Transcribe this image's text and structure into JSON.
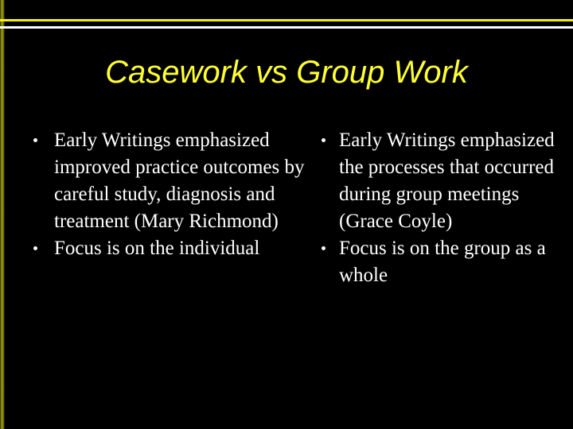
{
  "slide": {
    "title": "Casework vs Group Work",
    "background_color": "#000000",
    "title_color": "#ffff33",
    "body_text_color": "#ffffff",
    "accent_bar_color": "#9c9c00",
    "rule_yellow_color": "#f2f20c",
    "rule_white_color": "#ffffff",
    "columns": [
      {
        "id": "casework",
        "bullets": [
          "Early Writings emphasized improved practice outcomes by careful study, diagnosis and treatment (Mary Richmond)",
          "Focus is on the individual"
        ]
      },
      {
        "id": "group-work",
        "bullets": [
          "Early Writings emphasized the processes that occurred during group meetings (Grace Coyle)",
          "Focus is on the group as a whole"
        ]
      }
    ]
  }
}
